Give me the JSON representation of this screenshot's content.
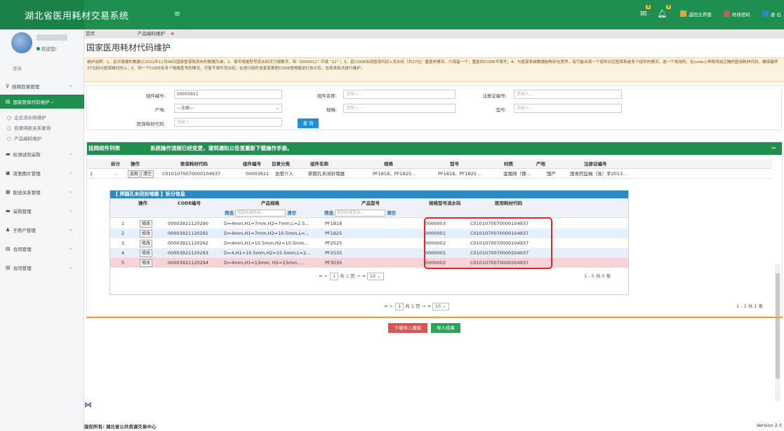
{
  "header": {
    "title": "湖北省医用耗材交易系统",
    "menu_icon": "≡",
    "mail_badge": "0",
    "bell_badge": "0",
    "home_label": "返回主界面",
    "password_label": "修改密码",
    "exit_label": "退 出",
    "colors": {
      "bar": "#1f8f4f",
      "home": "#f0a030",
      "password": "#d9534f",
      "exit": "#2b89c8"
    }
  },
  "sidebar": {
    "welcome": "欢迎您!",
    "menu_label": "菜单",
    "items": [
      {
        "label": "挂网目录管理",
        "icon": "♀"
      },
      {
        "label": "国家医保代码维护",
        "icon": "▤"
      },
      {
        "label": "检测试剂采购",
        "icon": "▬"
      },
      {
        "label": "资质图片管理",
        "icon": "▣"
      },
      {
        "label": "配送关系管理",
        "icon": "▦"
      },
      {
        "label": "采购管理",
        "icon": "▬"
      },
      {
        "label": "子用户管理",
        "icon": "♟"
      },
      {
        "label": "合同管理",
        "icon": "▤"
      },
      {
        "label": "合同管理",
        "icon": "▤"
      }
    ],
    "subitems": [
      {
        "label": "企业流水码维护"
      },
      {
        "label": "目录映射关系查询"
      },
      {
        "label": "产品编码维护"
      }
    ]
  },
  "tabs": [
    {
      "label": "首页"
    },
    {
      "label": "产品编码维护",
      "close": "×"
    }
  ],
  "page": {
    "title": "国家医用耗材代码维护",
    "notice": "维护说明：1、此次填报的数据以2021年11月06日国家医保局发布的数据为准；2、填写规格型号流水码可只填数字，如 “0000012” 可填 “12” ；3、若CODE出现医保代码+流水码（共27位）重复的情况，只保留一个，重复的CODE不填写；4、与医保系统数据结构存在差异，有可能出现一个组件对应医保系统多个组件的情况，选一个常用的，在code上再修改成正确的医用耗材代码，确保最终27位码与医保维对的上；5、同一个CODE有多个规格型号的情况，可暂不填写流水码，在进行组件信息变更把CODE按规格进行拆分后，在将来批次进行维护；"
  },
  "filter": {
    "component_no_label": "组件编号:",
    "component_no_value": "00003921",
    "component_name_label": "组件名称:",
    "component_name_placeholder": "请输入...",
    "reg_no_label": "注册证编号:",
    "reg_no_placeholder": "请输入...",
    "origin_label": "产地:",
    "origin_value": "—全部—",
    "spec_label": "规格:",
    "spec_placeholder": "请输入...",
    "model_label": "型号:",
    "model_placeholder": "请输入...",
    "code_label": "医保耗材代码:",
    "code_placeholder": "请输入...",
    "search_label": "查 询"
  },
  "panel": {
    "title": "挂网组件列表",
    "notice": "系统操作流程已经变更，请到通知公告里重新下载操作手册。",
    "minimize": "−",
    "headers": [
      "拆分",
      "操作",
      "医保耗材代码",
      "组件编号",
      "目录分类",
      "组件名称",
      "规格",
      "型号",
      "材质",
      "产地",
      "注册证编号"
    ],
    "row": {
      "index": "1",
      "split": "-",
      "btn_select": "选取",
      "btn_clear": "清空",
      "code": "C0101070070000104937",
      "component_no": "00003921",
      "category": "血管介入",
      "name": "卵圆孔未闭封堵器",
      "spec": "PF1818、PF1825...",
      "model": "PF1818、PF1825...",
      "material": "金属网（镍...",
      "origin": "国产",
      "reg_no": "国食药监械（准）字2013..."
    },
    "pager": {
      "first": "⇤",
      "prev": "⇠",
      "page": "1",
      "of": "共 1 页",
      "next": "⇢",
      "last": "⇥",
      "size": "10 ⌄",
      "summary": "1 - 1  共 1 条"
    }
  },
  "sub": {
    "title": "【 卵圆孔未闭封堵器 】拆分信息",
    "headers": [
      "操作",
      "CODE编号",
      "产品规格",
      "产品型号",
      "规格型号流水码",
      "医用耗材代码"
    ],
    "filter_label": "筛选",
    "filter_placeholder": "按回车键查询...",
    "clear_label": "清空",
    "edit_label": "修改",
    "rows": [
      {
        "n": "1",
        "code": "00003921120290",
        "spec": "D=4mm,H1=7mm,H2=7mm,L=2.5...",
        "model": "PF1818",
        "serial": "0000003",
        "med": "C0101070070000104937"
      },
      {
        "n": "2",
        "code": "00003921120291",
        "spec": "D=4mm,H1=7mm,H2=10.5mm,L=...",
        "model": "PF1825",
        "serial": "0000001",
        "med": "C0101070070000104937"
      },
      {
        "n": "3",
        "code": "00003921120292",
        "spec": "D=4mm,H1=10.5mm,H2=10.5mm...",
        "model": "PF2525",
        "serial": "0000002",
        "med": "C0101070070000104937"
      },
      {
        "n": "4",
        "code": "00003921120293",
        "spec": "D=4,H1=10.5mm,H2=15.5mm,L=2...",
        "model": "PF2535",
        "serial": "0000001",
        "med": "C0101070070000204937"
      },
      {
        "n": "5",
        "code": "00003921120294",
        "spec": "D=4mm,H1=13mm,  H2=13mm,  ...",
        "model": "PF3030",
        "serial": "0000002",
        "med": "C0101070070000204937"
      }
    ],
    "pager": {
      "first": "⇤",
      "prev": "⇠",
      "page": "1",
      "of": "共 1 页",
      "next": "⇢",
      "last": "⇥",
      "size": "10 ⌄",
      "summary": "1 - 5  共 5 条"
    }
  },
  "actions": {
    "download_template": "下载导入模板",
    "import_result": "导入结果"
  },
  "footer": {
    "copyright": "版权所有: 湖北省公共资源交易中心",
    "version": "Version 2.0",
    "vs_icon": "⋈"
  }
}
